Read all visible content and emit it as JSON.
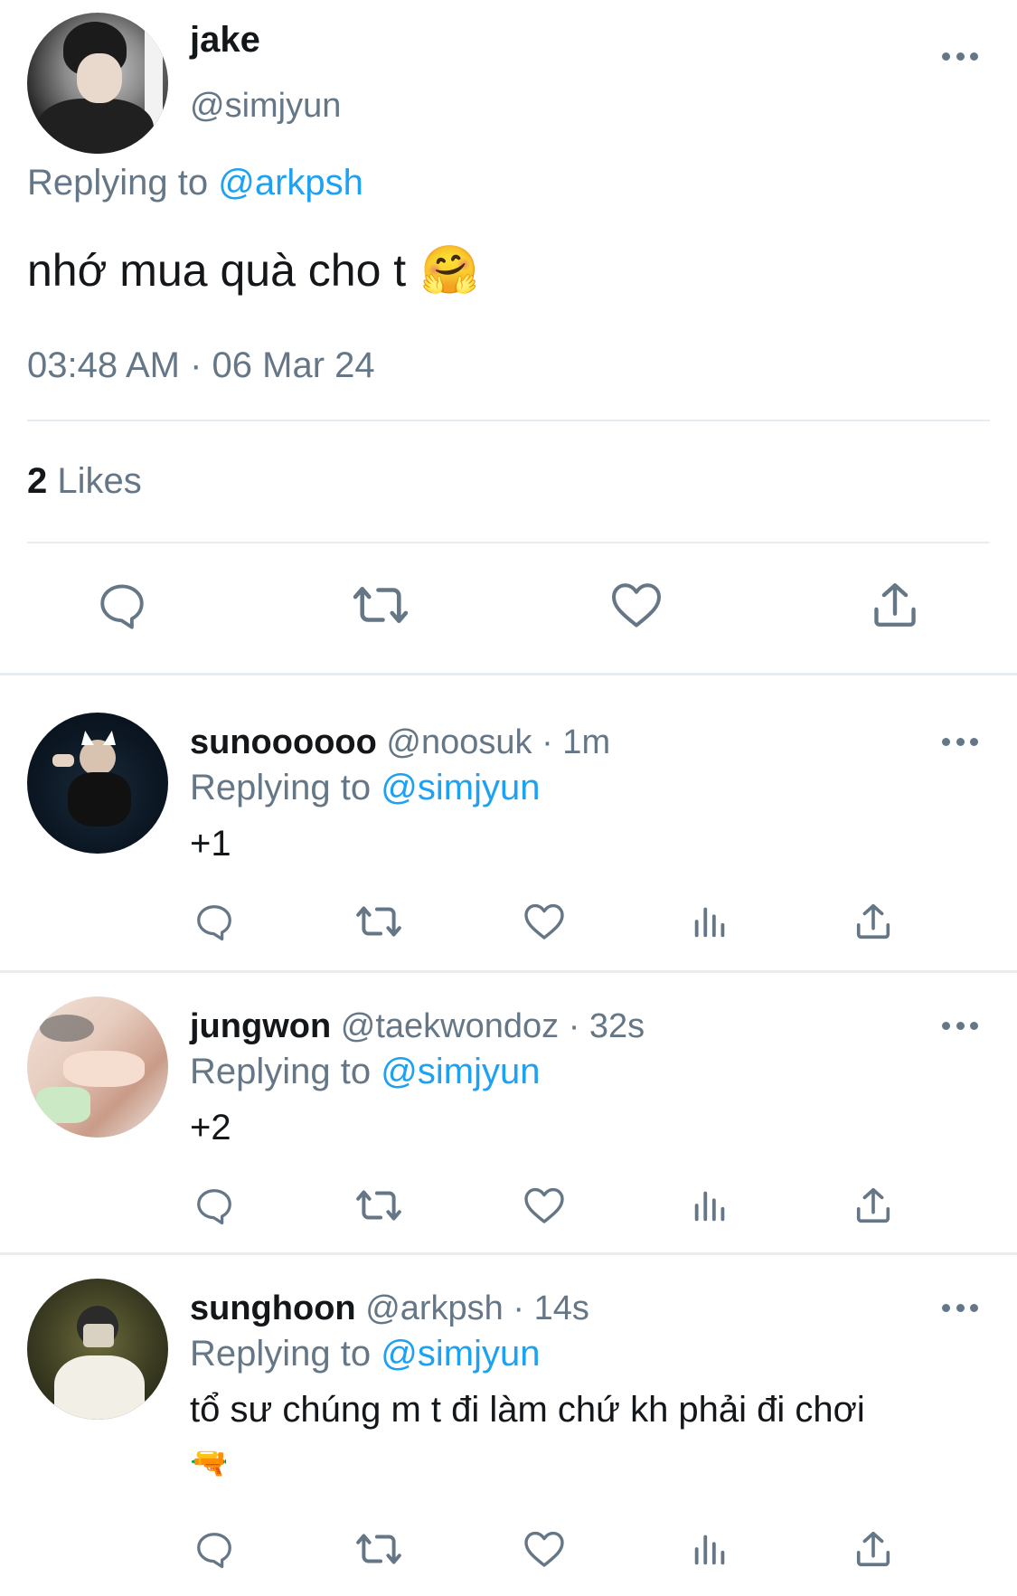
{
  "main_tweet": {
    "name": "jake",
    "handle": "@simjyun",
    "replying_prefix": "Replying to",
    "replying_to": "@arkpsh",
    "text": "nhớ mua quà cho t",
    "emoji": "🤗",
    "timestamp": "03:48 AM · 06 Mar 24",
    "likes_count": "2",
    "likes_label": " Likes",
    "icons": [
      "reply-icon",
      "retweet-icon",
      "like-icon",
      "share-icon"
    ]
  },
  "replies": [
    {
      "name": "sunoooooo",
      "handle": "@noosuk",
      "time": "· 1m",
      "replying_prefix": "Replying to",
      "replying_to": "@simjyun",
      "text": "+1"
    },
    {
      "name": "jungwon",
      "handle": "@taekwondoz",
      "time": "· 32s",
      "replying_prefix": "Replying to",
      "replying_to": "@simjyun",
      "text": "+2"
    },
    {
      "name": "sunghoon",
      "handle": "@arkpsh",
      "time": "· 14s",
      "replying_prefix": "Replying to",
      "replying_to": "@simjyun",
      "text": "tổ sư chúng m t đi làm chứ kh phải đi chơi",
      "emoji": "🔫"
    }
  ],
  "reply_action_icons": [
    "reply-icon",
    "retweet-icon",
    "like-icon",
    "analytics-icon",
    "share-icon"
  ],
  "colors": {
    "link": "#1da1f2",
    "secondary_text": "#657786",
    "primary_text": "#14171a",
    "divider": "#e6ecf0"
  }
}
